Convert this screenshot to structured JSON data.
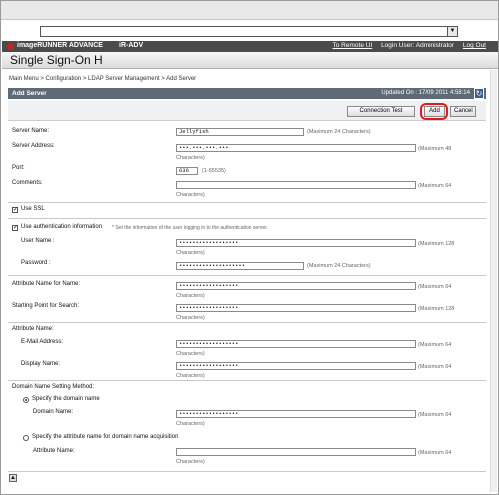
{
  "header": {
    "brand": "imageRUNNER ADVANCE",
    "model": "iR-ADV",
    "links": {
      "remote_ui": "To Remote UI",
      "login_user": "Login User: Administrator",
      "logout": "Log Out"
    },
    "app_title": "Single Sign-On H"
  },
  "breadcrumb": "Main Menu > Configuration > LDAP Server Management > Add Server",
  "panel": {
    "title": "Add Server",
    "updated": "Updated On : 17/09 2011 4:58:14"
  },
  "buttons": {
    "connection_test": "Connection Test",
    "add": "Add",
    "cancel": "Cancel"
  },
  "form": {
    "server_name": {
      "label": "Server Name:",
      "value": "Jellyfish",
      "hint": "(Maximum 24 Characters)"
    },
    "server_address": {
      "label": "Server Address:",
      "value": "•••.•••.•••.•••",
      "hint": "(Maximum 48 Characters)"
    },
    "port": {
      "label": "Port:",
      "value": "636",
      "hint": "(1-65535)"
    },
    "comments": {
      "label": "Comments:",
      "value": "",
      "hint": "(Maximum 64 Characters)"
    },
    "use_ssl": {
      "label": "Use SSL",
      "checked": true
    },
    "use_auth": {
      "label": "Use authentication information",
      "note": "* Set the information of the user logging in to the authentication server.",
      "checked": true
    },
    "user_name": {
      "label": "User Name :",
      "value": "••••••••••••••••••",
      "hint": "(Maximum 128 Characters)"
    },
    "password": {
      "label": "Password :",
      "value": "••••••••••••••••••••",
      "hint": "(Maximum 24 Characters)"
    },
    "attr_name_for_name": {
      "label": "Attribute Name for Name:",
      "value": "••••••••••••••••••",
      "hint": "(Maximum 64 Characters)"
    },
    "starting_point": {
      "label": "Starting Point for Search:",
      "value": "••••••••••••••••••",
      "hint": "(Maximum 128 Characters)"
    },
    "attribute_name": {
      "label": "Attribute Name:"
    },
    "email_address": {
      "label": "E-Mail Address:",
      "value": "••••••••••••••••••",
      "hint": "(Maximum 64 Characters)"
    },
    "display_name": {
      "label": "Display Name:",
      "value": "••••••••••••••••••",
      "hint": "(Maximum 64 Characters)"
    },
    "domain_method": {
      "label": "Domain Name Setting Method:"
    },
    "specify_domain": {
      "label": "Specify the domain name",
      "selected": true
    },
    "domain_name": {
      "label": "Domain Name:",
      "value": "••••••••••••••••••",
      "hint": "(Maximum 64 Characters)"
    },
    "specify_attr": {
      "label": "Specify the attribute name for domain name acquisition",
      "selected": false
    },
    "attr_name": {
      "label": "Attribute Name:",
      "value": "",
      "hint": "(Maximum 64 Characters)"
    }
  }
}
